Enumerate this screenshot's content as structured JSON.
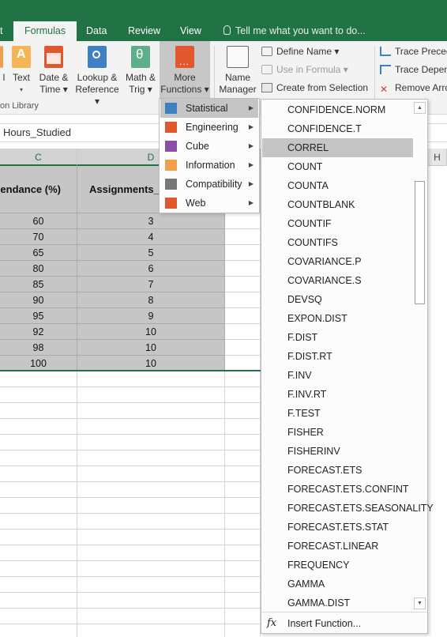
{
  "tabs": [
    {
      "label": "t",
      "active": false
    },
    {
      "label": "Formulas",
      "active": true
    },
    {
      "label": "Data",
      "active": false
    },
    {
      "label": "Review",
      "active": false
    },
    {
      "label": "View",
      "active": false
    }
  ],
  "tell_me": "Tell me what you want to do...",
  "ribbon": {
    "buttons": {
      "partial_l": "l",
      "text": [
        "Text",
        "▾"
      ],
      "date_time": [
        "Date &",
        "Time ▾"
      ],
      "lookup": [
        "Lookup &",
        "Reference ▾"
      ],
      "math": [
        "Math &",
        "Trig ▾"
      ],
      "more": [
        "More",
        "Functions ▾"
      ],
      "name_manager": [
        "Name",
        "Manager"
      ]
    },
    "defined_names": {
      "define_name": "Define Name ▾",
      "use_in_formula": "Use in Formula ▾",
      "create_from_selection": "Create from Selection"
    },
    "auditing": {
      "trace_precedents": "Trace Preced",
      "trace_dependents": "Trace Depend",
      "remove_arrows": "Remove Arro"
    },
    "group_label": "on Library"
  },
  "formula_bar": {
    "value": "Hours_Studied"
  },
  "columns": {
    "c": "C",
    "d": "D",
    "h": "H"
  },
  "sheet": {
    "header_c": "endance (%)",
    "header_d": "Assignments_C",
    "rows": [
      {
        "c": "60",
        "d": "3"
      },
      {
        "c": "70",
        "d": "4"
      },
      {
        "c": "65",
        "d": "5"
      },
      {
        "c": "80",
        "d": "6"
      },
      {
        "c": "85",
        "d": "7"
      },
      {
        "c": "90",
        "d": "8"
      },
      {
        "c": "95",
        "d": "9"
      },
      {
        "c": "92",
        "d": "10"
      },
      {
        "c": "98",
        "d": "10"
      },
      {
        "c": "100",
        "d": "10"
      }
    ]
  },
  "categories": [
    {
      "label": "Statistical",
      "icon": "statistical-icon",
      "selected": true
    },
    {
      "label": "Engineering",
      "icon": "engineering-icon",
      "selected": false
    },
    {
      "label": "Cube",
      "icon": "cube-icon",
      "selected": false
    },
    {
      "label": "Information",
      "icon": "information-icon",
      "selected": false
    },
    {
      "label": "Compatibility",
      "icon": "compatibility-icon",
      "selected": false
    },
    {
      "label": "Web",
      "icon": "web-icon",
      "selected": false
    }
  ],
  "functions": [
    "CONFIDENCE.NORM",
    "CONFIDENCE.T",
    "CORREL",
    "COUNT",
    "COUNTA",
    "COUNTBLANK",
    "COUNTIF",
    "COUNTIFS",
    "COVARIANCE.P",
    "COVARIANCE.S",
    "DEVSQ",
    "EXPON.DIST",
    "F.DIST",
    "F.DIST.RT",
    "F.INV",
    "F.INV.RT",
    "F.TEST",
    "FISHER",
    "FISHERINV",
    "FORECAST.ETS",
    "FORECAST.ETS.CONFINT",
    "FORECAST.ETS.SEASONALITY",
    "FORECAST.ETS.STAT",
    "FORECAST.LINEAR",
    "FREQUENCY",
    "GAMMA",
    "GAMMA.DIST"
  ],
  "selected_function": "CORREL",
  "insert_function": {
    "icon": "fx",
    "label": "Insert Function..."
  },
  "colors": {
    "accent": "#217346",
    "menu_highlight": "#c5c5c5",
    "selection": "#c6c6c6"
  }
}
